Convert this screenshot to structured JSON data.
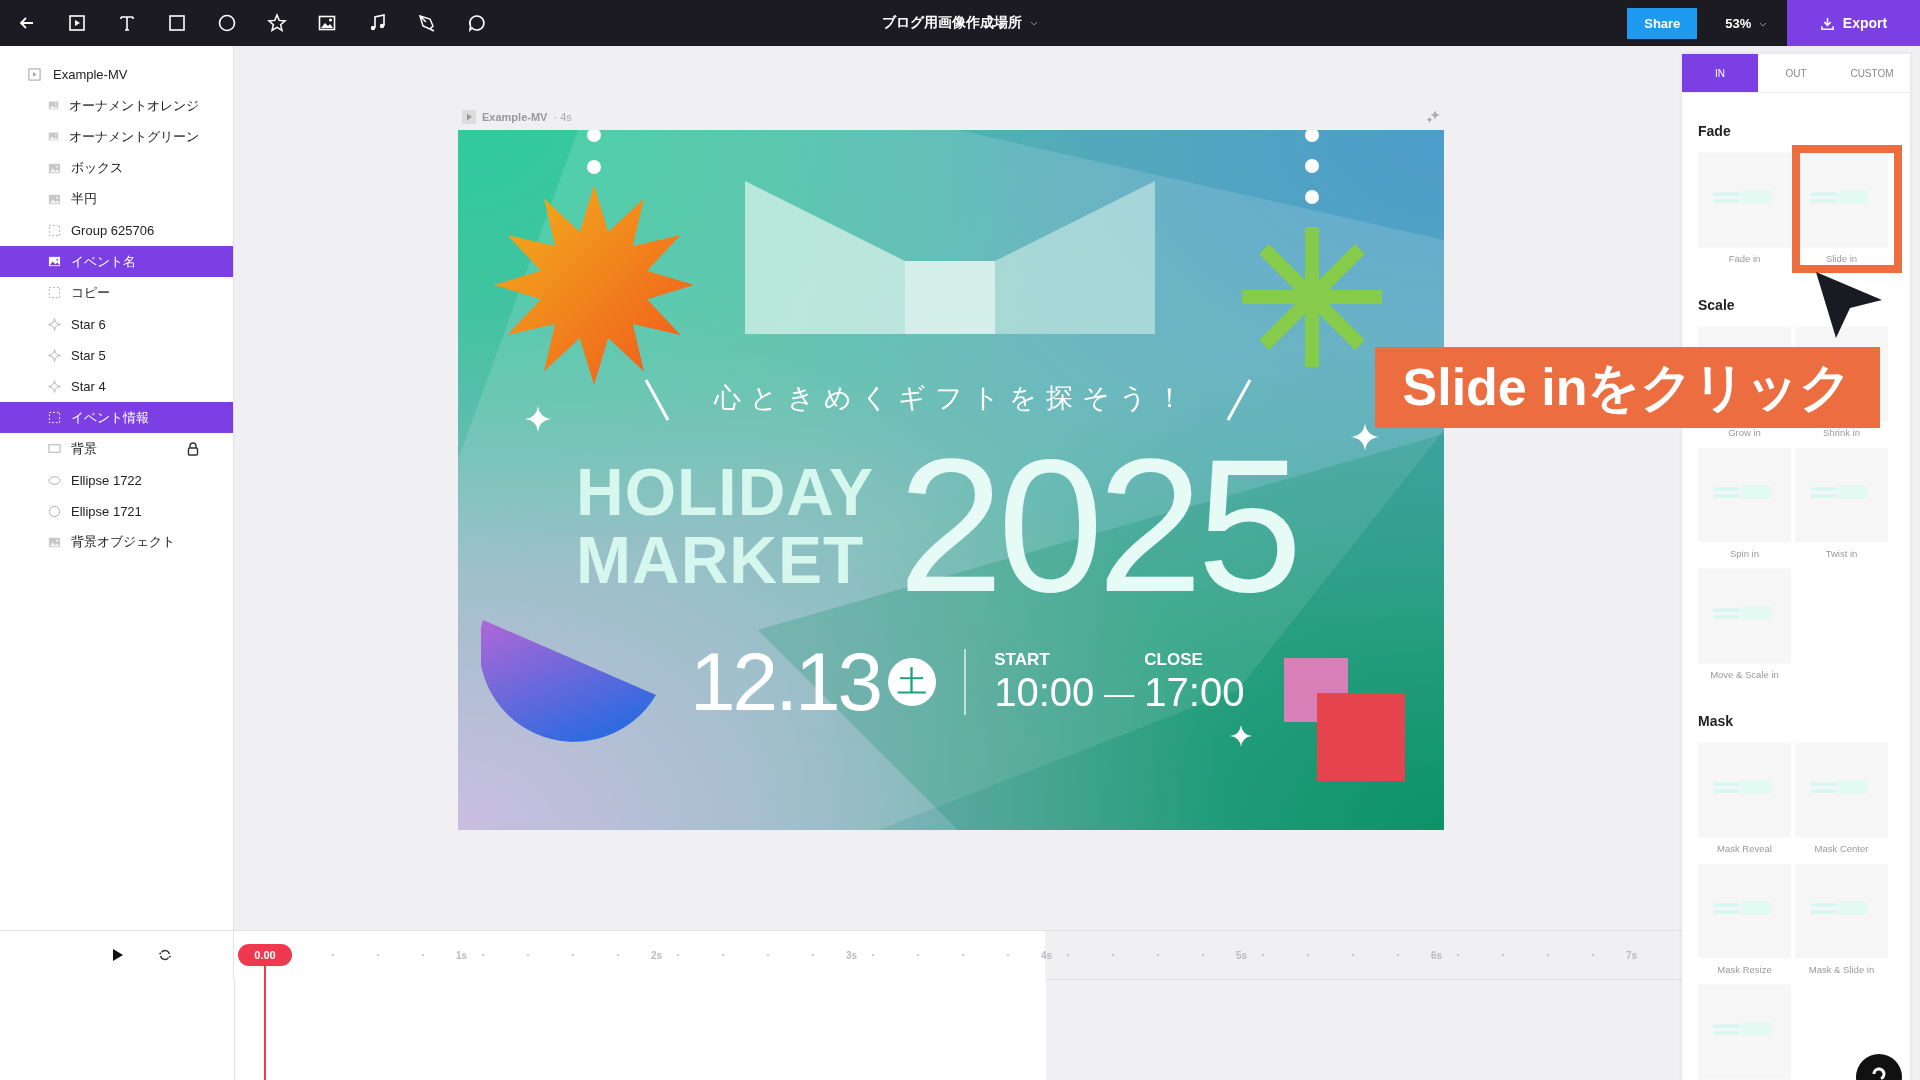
{
  "toolbar": {
    "title": "ブログ用画像作成場所",
    "share": "Share",
    "zoom": "53%",
    "export": "Export"
  },
  "layers": {
    "name": "Example-MV",
    "kind": "video",
    "children": [
      {
        "name": "オーナメントオレンジ",
        "kind": "image",
        "selected": false,
        "locked": false
      },
      {
        "name": "オーナメントグリーン",
        "kind": "image",
        "selected": false,
        "locked": false
      },
      {
        "name": "ボックス",
        "kind": "image",
        "selected": false,
        "locked": false
      },
      {
        "name": "半円",
        "kind": "image",
        "selected": false,
        "locked": false
      },
      {
        "name": "Group 625706",
        "kind": "group",
        "selected": false,
        "locked": false
      },
      {
        "name": "イベント名",
        "kind": "image",
        "selected": true,
        "locked": false
      },
      {
        "name": "コピー",
        "kind": "group",
        "selected": false,
        "locked": false
      },
      {
        "name": "Star 6",
        "kind": "star",
        "selected": false,
        "locked": false
      },
      {
        "name": "Star 5",
        "kind": "star",
        "selected": false,
        "locked": false
      },
      {
        "name": "Star 4",
        "kind": "star",
        "selected": false,
        "locked": false
      },
      {
        "name": "イベント情報",
        "kind": "group",
        "selected": true,
        "locked": false
      },
      {
        "name": "背景",
        "kind": "rect",
        "selected": false,
        "locked": true
      },
      {
        "name": "Ellipse 1722",
        "kind": "ellipse",
        "selected": false,
        "locked": false
      },
      {
        "name": "Ellipse 1721",
        "kind": "circle",
        "selected": false,
        "locked": false
      },
      {
        "name": "背景オブジェクト",
        "kind": "image",
        "selected": false,
        "locked": false
      }
    ]
  },
  "artboard": {
    "name": "Example-MV",
    "duration": "· 4s",
    "tagline": "心ときめくギフトを探そう！",
    "title_lines": [
      "HOLIDAY",
      "MARKET"
    ],
    "year": "2025",
    "date": "12.13",
    "weekday": "土",
    "start_label": "START",
    "start_time": "10:00",
    "dash": "—",
    "close_label": "CLOSE",
    "close_time": "17:00"
  },
  "animation_panel": {
    "tabs": [
      {
        "label": "IN",
        "selected": true
      },
      {
        "label": "OUT",
        "selected": false
      },
      {
        "label": "CUSTOM",
        "selected": false
      }
    ],
    "sections": [
      {
        "title": "Fade",
        "presets": [
          {
            "label": "Fade in"
          },
          {
            "label": "Slide in"
          }
        ]
      },
      {
        "title": "Scale",
        "presets": [
          {
            "label": "Grow in"
          },
          {
            "label": "Shrink in"
          },
          {
            "label": "Spin in"
          },
          {
            "label": "Twist in"
          },
          {
            "label": "Move & Scale in"
          }
        ]
      },
      {
        "title": "Mask",
        "presets": [
          {
            "label": "Mask Reveal"
          },
          {
            "label": "Mask Center"
          },
          {
            "label": "Mask Resize"
          },
          {
            "label": "Mask & Slide in"
          },
          {
            "kind": "preview_only"
          }
        ]
      }
    ]
  },
  "timeline": {
    "playhead": "0.00",
    "ticks": [
      "1s",
      "2s",
      "3s",
      "4s",
      "5s",
      "6s",
      "7s"
    ]
  },
  "annotation": {
    "text": "Slide inをクリック"
  }
}
